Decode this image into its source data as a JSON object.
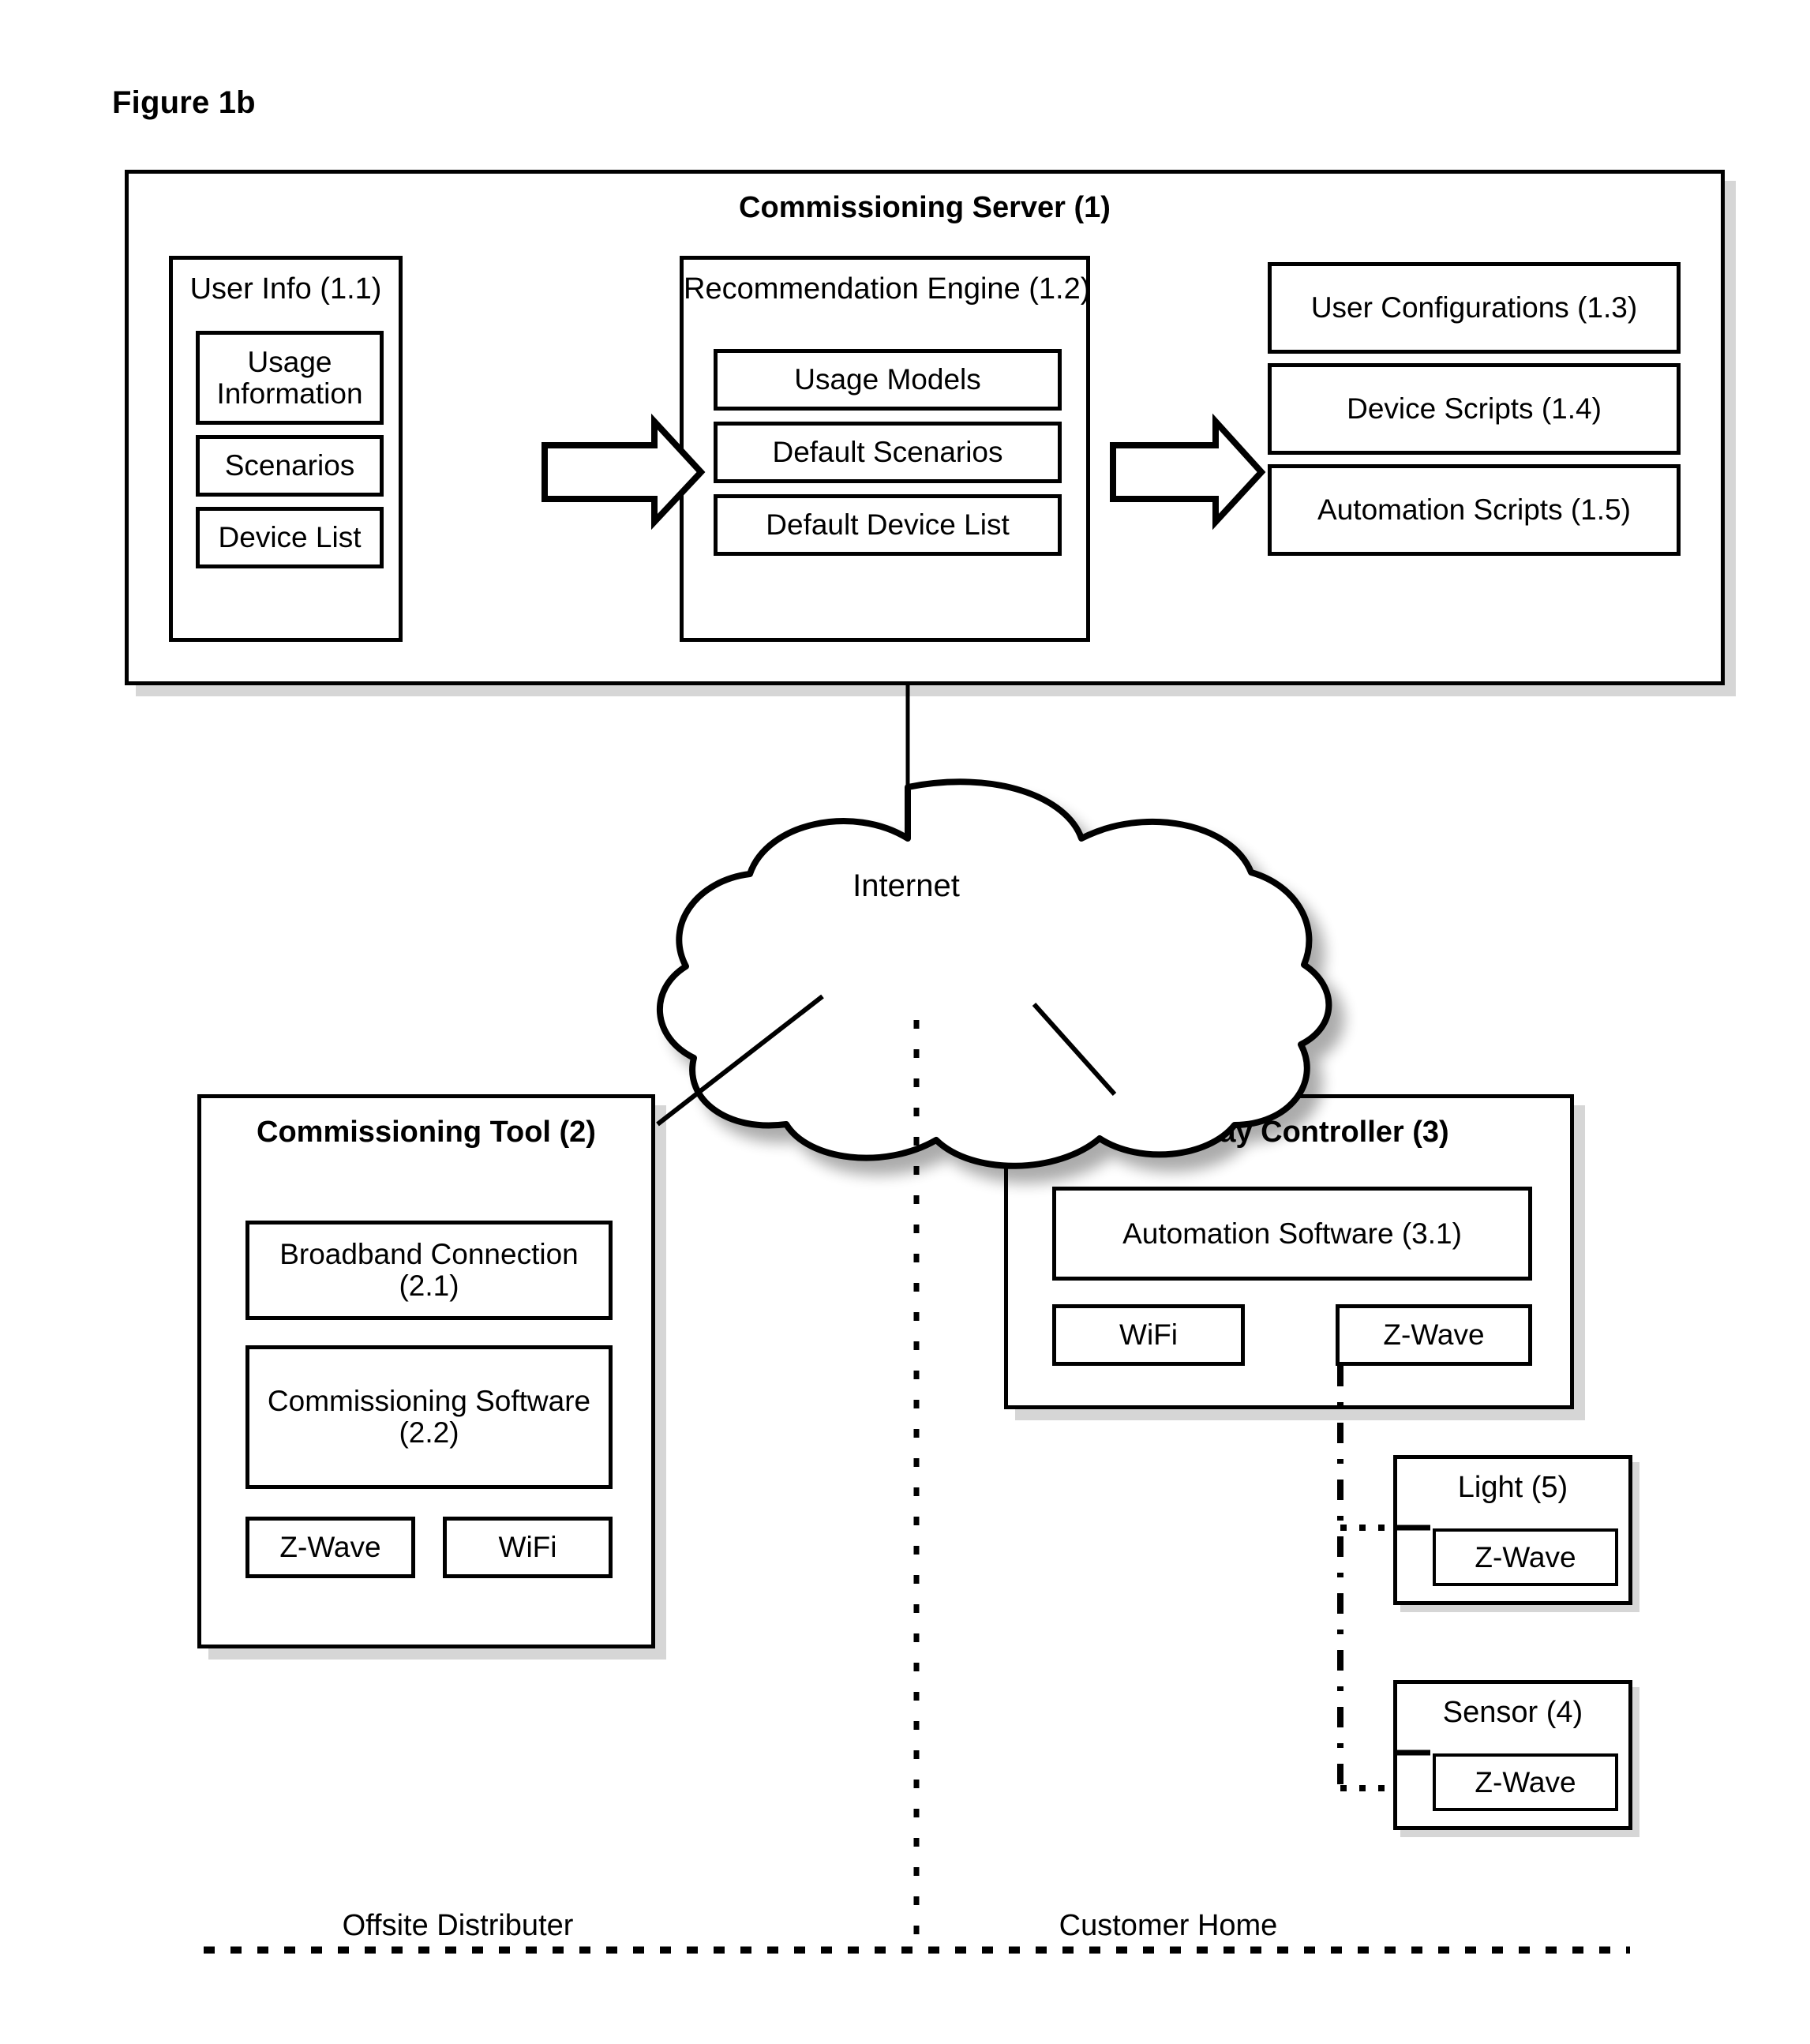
{
  "figure": {
    "label": "Figure 1b"
  },
  "server": {
    "title": "Commissioning Server (1)",
    "user_info": {
      "title": "User Info (1.1)",
      "items": [
        "Usage Information",
        "Scenarios",
        "Device List"
      ]
    },
    "recommendation_engine": {
      "title": "Recommendation Engine  (1.2)",
      "items": [
        "Usage Models",
        "Default Scenarios",
        "Default Device List"
      ]
    },
    "outputs": [
      "User Configurations (1.3)",
      "Device Scripts (1.4)",
      "Automation Scripts (1.5)"
    ]
  },
  "cloud": {
    "label": "Internet"
  },
  "commissioning_tool": {
    "title": "Commissioning Tool (2)",
    "modules": [
      "Broadband Connection (2.1)",
      "Commissioning Software (2.2)"
    ],
    "radios": [
      "Z-Wave",
      "WiFi"
    ]
  },
  "gateway_controller": {
    "title": "Gateway Controller (3)",
    "modules": [
      "Automation Software (3.1)"
    ],
    "radios": [
      "WiFi",
      "Z-Wave"
    ]
  },
  "devices": [
    {
      "title": "Light (5)",
      "radio": "Z-Wave"
    },
    {
      "title": "Sensor (4)",
      "radio": "Z-Wave"
    }
  ],
  "regions": {
    "left": "Offsite Distributer",
    "right": "Customer Home"
  },
  "colors": {
    "stroke": "#000000",
    "background": "#ffffff",
    "shadow": "rgba(0,0,0,0.16)"
  }
}
